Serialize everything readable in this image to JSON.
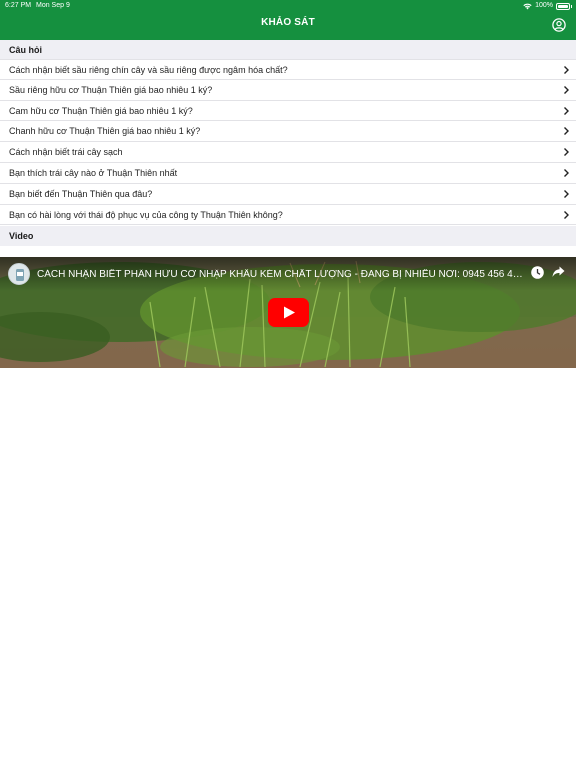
{
  "status_bar": {
    "time": "6:27 PM",
    "date": "Mon Sep 9",
    "battery": "100%",
    "wifi_icon": "wifi-icon",
    "battery_icon": "battery-icon"
  },
  "nav": {
    "title": "KHẢO SÁT",
    "account_icon": "account-icon"
  },
  "sections": {
    "questions_header": "Câu hỏi",
    "video_header": "Video"
  },
  "questions": [
    {
      "label": "Cách nhận biết sầu riêng chín cây và sầu riêng được ngâm hóa chất?"
    },
    {
      "label": "Sầu riêng hữu cơ Thuận Thiên giá bao nhiêu 1 ký?"
    },
    {
      "label": "Cam hữu cơ Thuận Thiên giá bao nhiêu 1 ký?"
    },
    {
      "label": "Chanh hữu cơ Thuận Thiên giá bao nhiêu 1 ký?"
    },
    {
      "label": "Cách nhận biết trái cây sạch"
    },
    {
      "label": "Bạn thích trái cây nào ở Thuận Thiên nhất"
    },
    {
      "label": "Bạn biết đến Thuận Thiên qua đâu?"
    },
    {
      "label": "Bạn có hài lòng với thái độ phục vụ của công ty Thuận Thiên không?"
    }
  ],
  "video": {
    "title": "CÁCH NHẬN BIẾT PHÂN HỮU CƠ NHẬP KHẨU KÉM CHẤT LƯỢNG - ĐANG BỊ NHIỀU NƠI: 0945 456 45...",
    "play_icon": "youtube-play-icon",
    "watch_later_icon": "clock-icon",
    "share_icon": "share-icon"
  },
  "colors": {
    "header_green": "#15903f",
    "section_bg": "#efeff4",
    "play_red": "#ff0000"
  }
}
